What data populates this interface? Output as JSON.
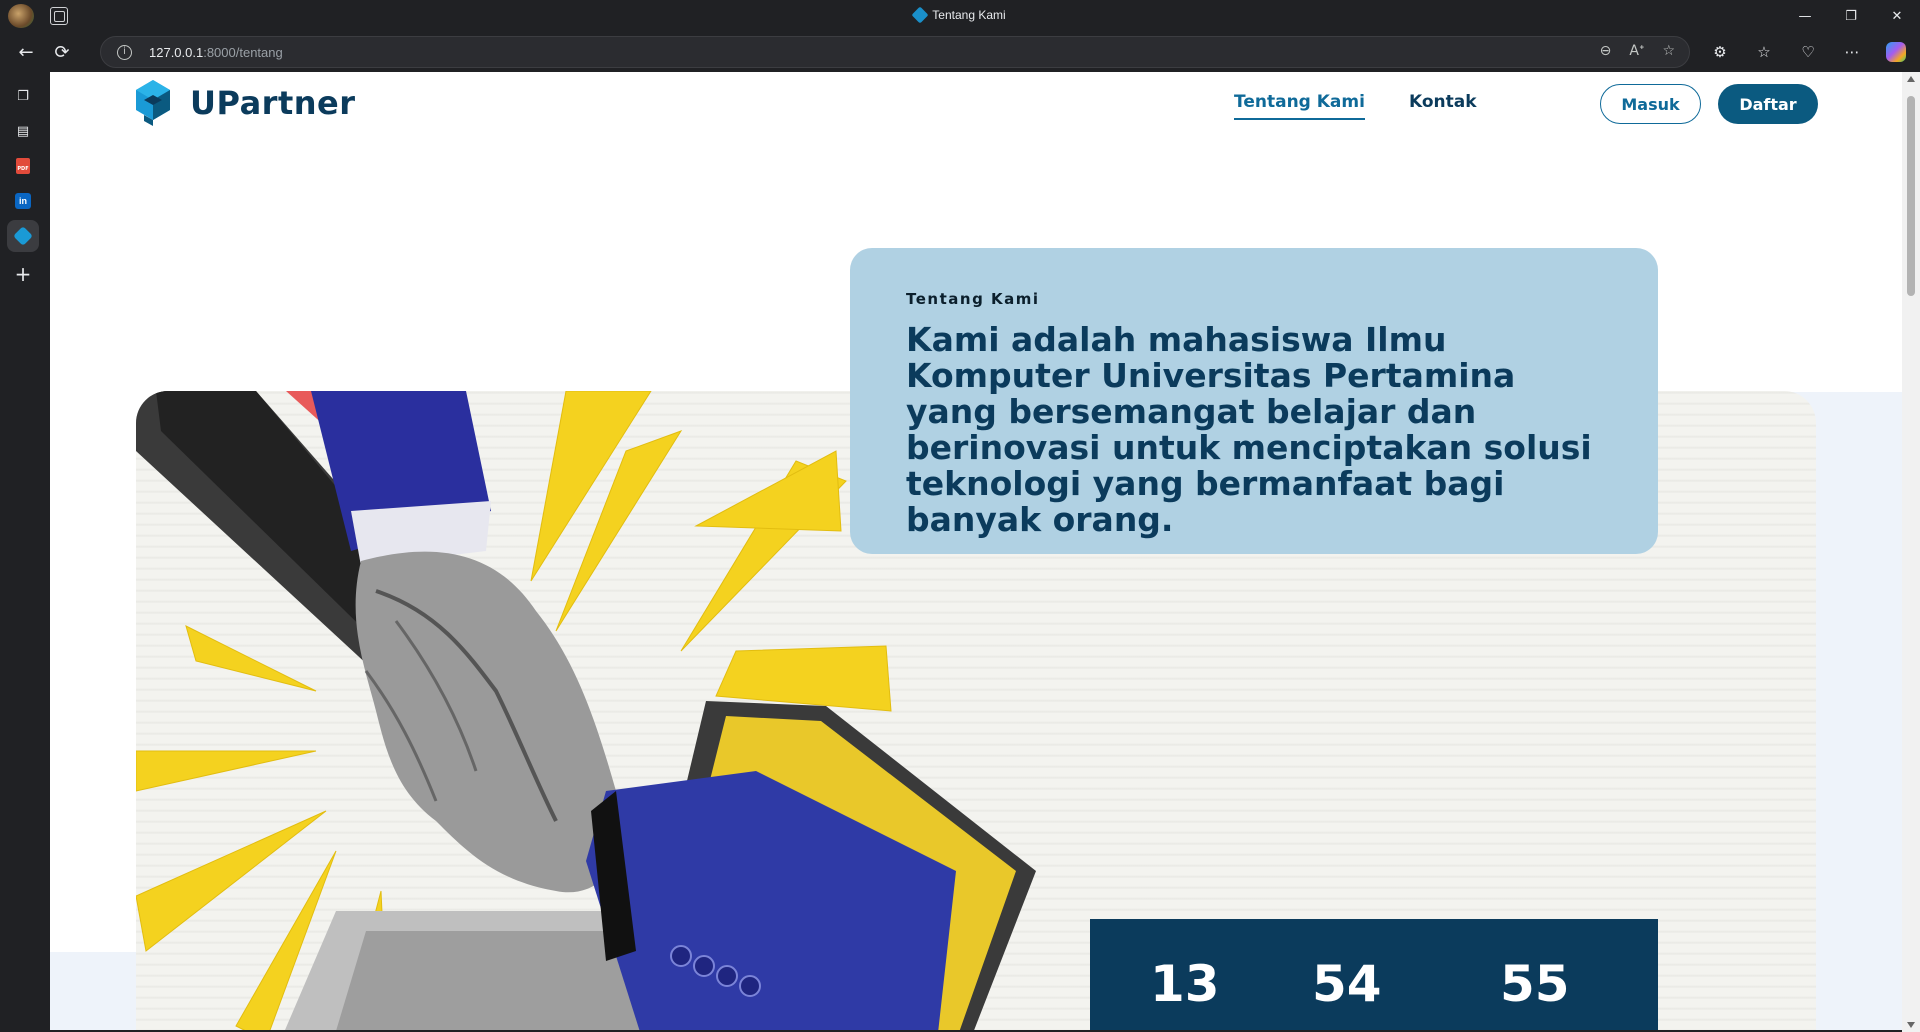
{
  "browser": {
    "tab_title": "Tentang Kami",
    "url_host": "127.0.0.1",
    "url_path": ":8000/tentang",
    "window_controls": [
      "—",
      "❐",
      "✕"
    ]
  },
  "site": {
    "brand": "UPartner",
    "menu": [
      {
        "label": "Tentang Kami",
        "active": true
      },
      {
        "label": "Kontak",
        "active": false
      }
    ],
    "login_label": "Masuk",
    "register_label": "Daftar"
  },
  "about": {
    "label": "Tentang Kami",
    "text": "Kami adalah mahasiswa Ilmu Komputer Universitas Pertamina yang bersemangat belajar dan berinovasi untuk menciptakan solusi teknologi yang bermanfaat bagi banyak orang."
  },
  "stats": [
    "13",
    "54",
    "55"
  ],
  "colors": {
    "brand_dark": "#0b3b5c",
    "brand_accent": "#0f6a99",
    "card_bg": "#b0d1e3",
    "yellow": "#f4d21f",
    "suit_blue": "#2a2f9e"
  }
}
